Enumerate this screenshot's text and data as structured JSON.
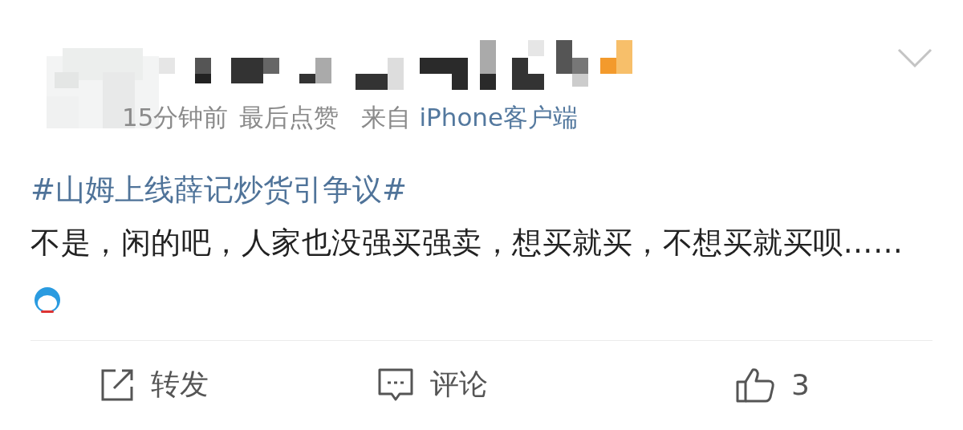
{
  "post": {
    "meta": [
      {
        "text": "15分钟前",
        "kind": "plain"
      },
      {
        "text": "最后点赞",
        "kind": "plain"
      },
      {
        "text": "来自",
        "kind": "plain"
      },
      {
        "text": "iPhone客户端",
        "kind": "link"
      }
    ],
    "topic": "#山姆上线薛记炒货引争议#",
    "body": "不是，闲的吧，人家也没强买强卖，想买就买，不想买就买呗……"
  },
  "actions": [
    {
      "kind": "repost",
      "label": "转发"
    },
    {
      "kind": "comment",
      "label": "评论"
    },
    {
      "kind": "like",
      "label": "3"
    }
  ]
}
